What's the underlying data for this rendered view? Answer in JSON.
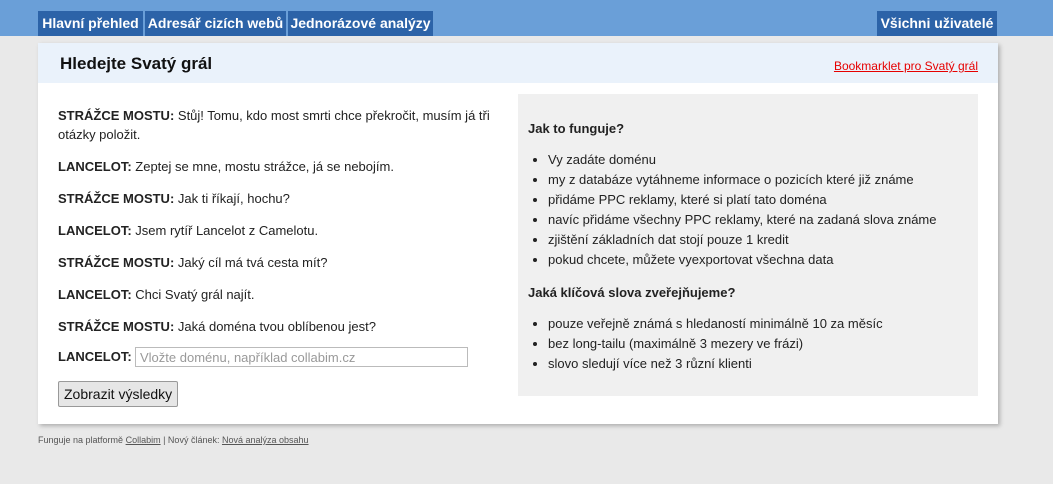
{
  "nav": {
    "tabs": [
      "Hlavní přehled",
      "Adresář cizích webů",
      "Jednorázové analýzy"
    ],
    "users_label": "Všichni uživatelé"
  },
  "card": {
    "title": "Hledejte Svatý grál",
    "bookmarklet_link": "Bookmarklet pro Svatý grál"
  },
  "dialogue": [
    {
      "speaker": "STRÁŽCE MOSTU:",
      "text": " Stůj! Tomu, kdo most smrti chce překročit, musím já tři otázky položit."
    },
    {
      "speaker": "LANCELOT:",
      "text": " Zeptej se mne, mostu strážce, já se nebojím."
    },
    {
      "speaker": "STRÁŽCE MOSTU:",
      "text": " Jak ti říkají, hochu?"
    },
    {
      "speaker": "LANCELOT:",
      "text": " Jsem rytíř Lancelot z Camelotu."
    },
    {
      "speaker": "STRÁŽCE MOSTU:",
      "text": " Jaký cíl má tvá cesta mít?"
    },
    {
      "speaker": "LANCELOT:",
      "text": " Chci Svatý grál najít."
    },
    {
      "speaker": "STRÁŽCE MOSTU:",
      "text": " Jaká doména tvou oblíbenou jest?"
    }
  ],
  "form": {
    "speaker": "LANCELOT:",
    "placeholder": "Vložte doménu, například collabim.cz",
    "value": "",
    "submit_label": "Zobrazit výsledky"
  },
  "info": {
    "how_title": "Jak to funguje?",
    "how_items": [
      "Vy zadáte doménu",
      "my z databáze vytáhneme informace o pozicích které již známe",
      "přidáme PPC reklamy, které si platí tato doména",
      "navíc přidáme všechny PPC reklamy, které na zadaná slova známe",
      "zjištění základních dat stojí pouze 1 kredit",
      "pokud chcete, můžete vyexportovat všechna data"
    ],
    "keywords_title": "Jaká klíčová slova zveřejňujeme?",
    "keywords_items": [
      "pouze veřejně známá s hledaností minimálně 10 za měsíc",
      "bez long-tailu (maximálně 3 mezery ve frázi)",
      "slovo sledují více než 3 různí klienti"
    ]
  },
  "footer": {
    "platform_text": "Funguje na platformě",
    "platform_link": "Collabim",
    "separator": " | Nový článek: ",
    "article_link": "Nová analýza obsahu"
  }
}
